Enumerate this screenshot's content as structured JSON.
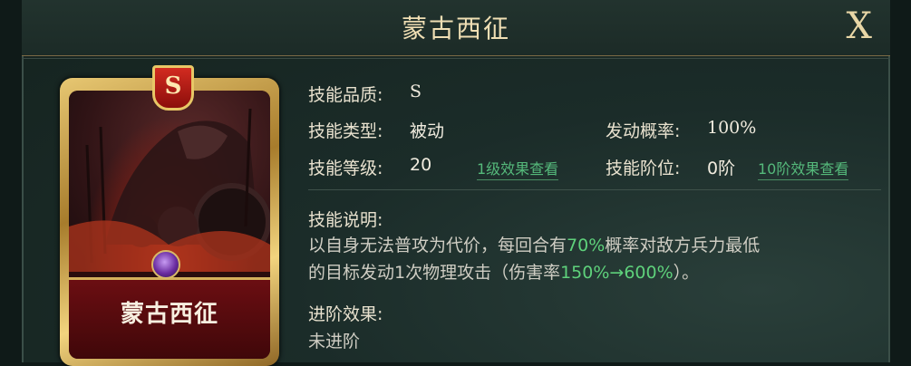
{
  "title": "蒙古西征",
  "close_label": "X",
  "card": {
    "grade": "S",
    "name": "蒙古西征"
  },
  "skill": {
    "quality_label": "技能品质:",
    "quality_value": "S",
    "type_label": "技能类型:",
    "type_value": "被动",
    "trigger_label": "发动概率:",
    "trigger_value": "100%",
    "level_label": "技能等级:",
    "level_value": "20",
    "level_link": "1级效果查看",
    "rank_label": "技能阶位:",
    "rank_value": "0阶",
    "rank_link": "10阶效果查看",
    "desc_label": "技能说明:",
    "desc": {
      "line1_a": "以自身无法普攻为代价，每回合有",
      "line1_hl": "70%",
      "line1_b": "概率对敌方兵力最低",
      "line2_a": "的目标发动1次物理攻击（伤害率",
      "line2_hl": "150%→600%",
      "line2_b": "）。"
    },
    "advance_label": "进阶效果:",
    "advance_value": "未进阶"
  },
  "colors": {
    "highlight": "#5ed17b",
    "link": "#55b97b",
    "title_gold": "#f0dfb4"
  }
}
